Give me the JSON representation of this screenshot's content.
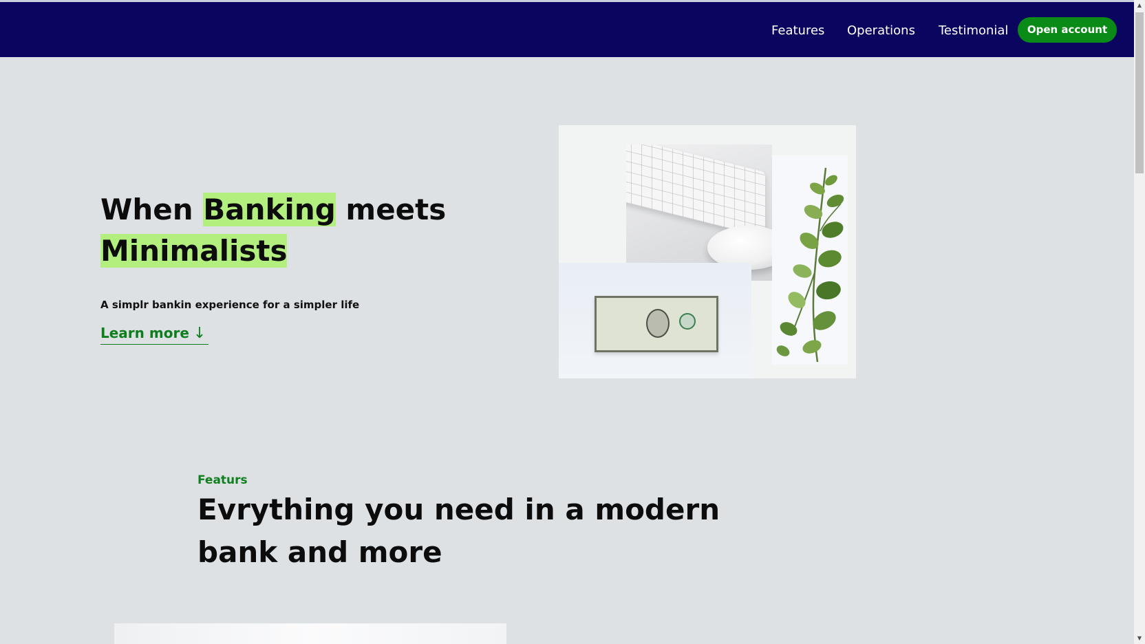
{
  "nav": {
    "links": [
      "Features",
      "Operations",
      "Testimonial"
    ],
    "cta_label": "Open account"
  },
  "hero": {
    "title_part1": "When ",
    "title_highlight1": "Banking",
    "title_part2": " meets",
    "title_highlight2": "Minimalists",
    "subtitle": "A simplr bankin experience for a simpler life",
    "learn_more": "Learn more",
    "learn_more_icon": "↓"
  },
  "features": {
    "tag": "Featurs",
    "heading": "Evrything you need in a modern bank and more"
  },
  "colors": {
    "nav_bg": "#0a0660",
    "page_bg": "#dee1e3",
    "accent_green": "#0a8a16",
    "highlight": "#b3ef7e"
  },
  "icons": {
    "learn_more": "arrow-down-icon",
    "scroll_up": "scroll-up-arrow-icon",
    "scroll_down": "scroll-down-arrow-icon"
  },
  "scrollbar": {
    "up_glyph": "▲",
    "down_glyph": "▼"
  }
}
